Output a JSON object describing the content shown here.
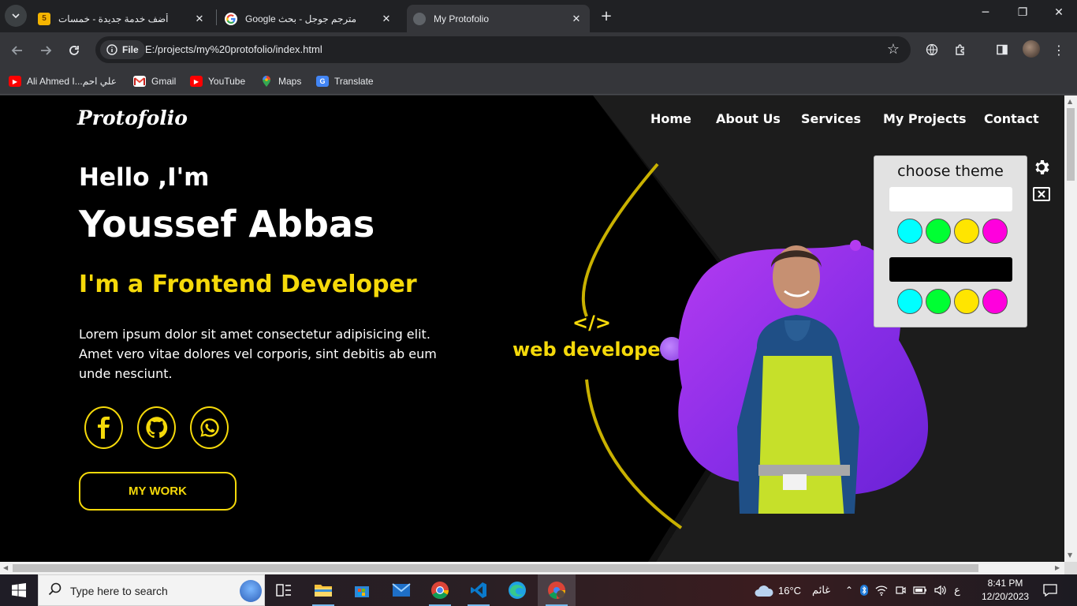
{
  "browser": {
    "tabs": [
      {
        "title": "أضف خدمة جديدة - خمسات",
        "favicon": "khamsat-favicon",
        "active": false
      },
      {
        "title": "مترجم جوجل - بحث Google",
        "favicon": "google-favicon",
        "active": false
      },
      {
        "title": "My Protofolio",
        "favicon": "globe-favicon",
        "active": true
      }
    ],
    "site_info_label": "File",
    "url": "E:/projects/my%20protofolio/index.html",
    "bookmarks": [
      {
        "label": "Ali Ahmed I...علي احم",
        "icon": "youtube-icon"
      },
      {
        "label": "Gmail",
        "icon": "gmail-icon"
      },
      {
        "label": "YouTube",
        "icon": "youtube-icon"
      },
      {
        "label": "Maps",
        "icon": "maps-icon"
      },
      {
        "label": "Translate",
        "icon": "translate-icon"
      }
    ]
  },
  "page": {
    "logo": "Protofolio",
    "nav": [
      "Home",
      "About Us",
      "Services",
      "My Projects",
      "Contact"
    ],
    "hello": "Hello ,I'm",
    "name": "Youssef Abbas",
    "role": "I'm a Frontend Developer",
    "description": "Lorem ipsum dolor sit amet consectetur adipisicing elit. Amet vero vitae dolores vel corporis, sint debitis ab eum unde nesciunt.",
    "social": [
      "facebook-icon",
      "github-icon",
      "whatsapp-icon"
    ],
    "cta": "MY WORK",
    "code_symbol": "</>",
    "badge": "web developer",
    "accent_color": "#f5d90a",
    "theme_panel": {
      "title": "choose theme",
      "modes": [
        "light",
        "dark"
      ],
      "colors": [
        "#00ffff",
        "#00ff33",
        "#ffe500",
        "#ff00dd"
      ]
    }
  },
  "taskbar": {
    "search_placeholder": "Type here to search",
    "apps": [
      "task-view-icon",
      "file-explorer-icon",
      "microsoft-store-icon",
      "mail-icon",
      "chrome-icon",
      "vscode-icon",
      "edge-icon",
      "chrome-profile-icon"
    ],
    "weather": "16°C",
    "weather_desc": "غائم",
    "lang": "ع",
    "time": "8:41 PM",
    "date": "12/20/2023"
  }
}
